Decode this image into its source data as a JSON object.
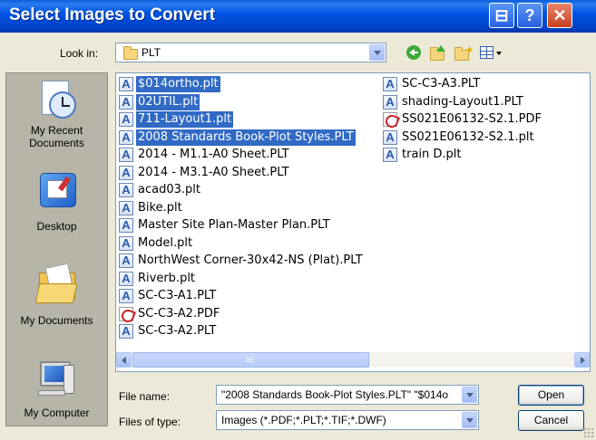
{
  "window": {
    "title": "Select Images to Convert",
    "help_label": "?",
    "close_label": "✕",
    "context_label": "⊟"
  },
  "lookin": {
    "label": "Look in:",
    "value": "PLT"
  },
  "places": [
    {
      "label1": "My Recent",
      "label2": "Documents",
      "icon": "recent-documents-icon"
    },
    {
      "label1": "Desktop",
      "label2": "",
      "icon": "desktop-icon"
    },
    {
      "label1": "My Documents",
      "label2": "",
      "icon": "my-documents-icon"
    },
    {
      "label1": "My Computer",
      "label2": "",
      "icon": "my-computer-icon"
    }
  ],
  "files": {
    "col1": [
      {
        "name": "$014ortho.plt",
        "type": "plt",
        "selected": true
      },
      {
        "name": "02UTIL.plt",
        "type": "plt",
        "selected": true
      },
      {
        "name": "711-Layout1.plt",
        "type": "plt",
        "selected": true
      },
      {
        "name": "2008 Standards Book-Plot Styles.PLT",
        "type": "plt",
        "selected": true
      },
      {
        "name": "2014 - M1.1-A0 Sheet.PLT",
        "type": "plt",
        "selected": false
      },
      {
        "name": "2014 - M3.1-A0 Sheet.PLT",
        "type": "plt",
        "selected": false
      },
      {
        "name": "acad03.plt",
        "type": "plt",
        "selected": false
      },
      {
        "name": "Bike.plt",
        "type": "plt",
        "selected": false
      },
      {
        "name": "Master Site Plan-Master Plan.PLT",
        "type": "plt",
        "selected": false
      },
      {
        "name": "Model.plt",
        "type": "plt",
        "selected": false
      },
      {
        "name": "NorthWest Corner-30x42-NS (Plat).PLT",
        "type": "plt",
        "selected": false
      },
      {
        "name": "Riverb.plt",
        "type": "plt",
        "selected": false
      },
      {
        "name": "SC-C3-A1.PLT",
        "type": "plt",
        "selected": false
      },
      {
        "name": "SC-C3-A2.PDF",
        "type": "pdf",
        "selected": false
      },
      {
        "name": "SC-C3-A2.PLT",
        "type": "plt",
        "selected": false
      }
    ],
    "col2": [
      {
        "name": "SC-C3-A3.PLT",
        "type": "plt",
        "selected": false
      },
      {
        "name": "shading-Layout1.PLT",
        "type": "plt",
        "selected": false
      },
      {
        "name": "SS021E06132-S2.1.PDF",
        "type": "pdf",
        "selected": false
      },
      {
        "name": "SS021E06132-S2.1.plt",
        "type": "plt",
        "selected": false
      },
      {
        "name": "train D.plt",
        "type": "plt",
        "selected": false
      }
    ]
  },
  "filename": {
    "label": "File name:",
    "value": "\"2008 Standards Book-Plot Styles.PLT\" \"$014o"
  },
  "filetype": {
    "label": "Files of type:",
    "value": "Images (*.PDF;*.PLT;*.TIF;*.DWF)"
  },
  "buttons": {
    "open": "Open",
    "cancel": "Cancel"
  },
  "colors": {
    "selection": "#316AC5",
    "titlebar": "#0055E5",
    "face": "#ECE9D8"
  }
}
